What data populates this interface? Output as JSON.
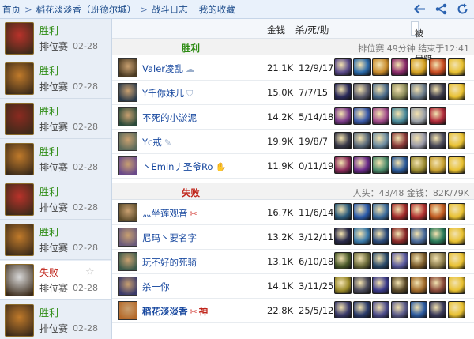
{
  "breadcrumb": {
    "home": "首页",
    "player": "稻花淡淡香（班德尔城）",
    "log": "战斗日志",
    "fav": "我的收藏",
    "sep": ">"
  },
  "toolbar_icons": [
    "back-arrow-icon",
    "share-icon",
    "refresh-icon"
  ],
  "sidebar": [
    {
      "result": "胜利",
      "kind": "win",
      "mode": "排位赛",
      "date": "02-28",
      "avatar_color": "#b8322a"
    },
    {
      "result": "胜利",
      "kind": "win",
      "mode": "排位赛",
      "date": "02-28",
      "avatar_color": "#c07a2a"
    },
    {
      "result": "胜利",
      "kind": "win",
      "mode": "排位赛",
      "date": "02-28",
      "avatar_color": "#8a2a20"
    },
    {
      "result": "胜利",
      "kind": "win",
      "mode": "排位赛",
      "date": "02-28",
      "avatar_color": "#c07a2a"
    },
    {
      "result": "胜利",
      "kind": "win",
      "mode": "排位赛",
      "date": "02-28",
      "avatar_color": "#b8322a"
    },
    {
      "result": "胜利",
      "kind": "win",
      "mode": "排位赛",
      "date": "02-28",
      "avatar_color": "#c07a2a"
    },
    {
      "result": "失败",
      "kind": "lose",
      "mode": "排位赛",
      "date": "02-28",
      "avatar_color": "#d8d8d8",
      "star": "☆"
    },
    {
      "result": "胜利",
      "kind": "win",
      "mode": "排位赛",
      "date": "02-28",
      "avatar_color": "#c07a2a"
    }
  ],
  "header": {
    "gold": "金钱",
    "kda": "杀/死/助",
    "ban": "被BAN英雄",
    "dropdown_icon": "⌄"
  },
  "win_team": {
    "label": "胜利",
    "meta": "排位赛 49分钟 结束于12:41"
  },
  "lose_team": {
    "label": "失败",
    "meta": "人头：43/48 金钱：82K/79K"
  },
  "win_rows": [
    {
      "name": "Valer凌乱",
      "gold": "21.1K",
      "kda": "12/9/17",
      "badge": "☁",
      "avatar": "#4a3a22"
    },
    {
      "name": "Y千你妹儿",
      "gold": "15.0K",
      "kda": "7/7/15",
      "badge": "⛉",
      "avatar": "#2a3a4a"
    },
    {
      "name": "不死的小淤泥",
      "gold": "14.2K",
      "kda": "5/14/18",
      "badge": "",
      "avatar": "#2a4a3a"
    },
    {
      "name": "Yc戒",
      "gold": "19.9K",
      "kda": "19/8/7",
      "badge": "✎",
      "avatar": "#5a6a5a"
    },
    {
      "name": "丶Emin丿圣爷Ro",
      "gold": "11.9K",
      "kda": "0/11/19",
      "badge": "✋",
      "avatar": "#6a4a8a"
    }
  ],
  "lose_rows": [
    {
      "name": "灬坐莲观音",
      "gold": "16.7K",
      "kda": "11/6/14",
      "badge": "✂",
      "avatar": "#5a4a2a"
    },
    {
      "name": "尼玛丶要名字",
      "gold": "13.2K",
      "kda": "3/12/11",
      "badge": "",
      "avatar": "#6a5a7a"
    },
    {
      "name": "玩不好的死骑",
      "gold": "13.1K",
      "kda": "6/10/18",
      "badge": "",
      "avatar": "#3a5a4a"
    },
    {
      "name": "杀一你",
      "gold": "14.1K",
      "kda": "3/11/25",
      "badge": "",
      "avatar": "#3a3a6a"
    },
    {
      "name": "稻花淡淡香",
      "gold": "22.8K",
      "kda": "25/5/12",
      "badge": "✂",
      "shen": "神",
      "me": true,
      "avatar": "#b56a2a"
    }
  ],
  "item_colors": [
    [
      "#5a4a8a",
      "#2a6aaa",
      "#c88a2a",
      "#8a2a6a",
      "#d4a020",
      "#c84a20",
      "#e8c030"
    ],
    [
      "#2a2a5a",
      "#5a5a6a",
      "#4a6a8a",
      "#8a8a5a",
      "#6a7a8a",
      "#3a3a4a",
      "#e8c030"
    ],
    [
      "#7a3a8a",
      "#3a5aaa",
      "#a04a8a",
      "#4a8a9a",
      "#9aa0a8",
      "#b02a3a"
    ],
    [
      "#3a3a4a",
      "#5a6a7a",
      "#6a8aa0",
      "#8a3a3a",
      "#9a9aa8",
      "#4a4a5a",
      "#e8c030"
    ],
    [
      "#8a2a5a",
      "#6a2a8a",
      "#4a8a6a",
      "#2a5a9a",
      "#9a8a30",
      "#c8a030",
      "#e8c030"
    ],
    [
      "#2a5a7a",
      "#2a5aaa",
      "#3a6a9a",
      "#a02a2a",
      "#b03030",
      "#c05a20",
      "#e8c030"
    ],
    [
      "#2a2a4a",
      "#3a7aaa",
      "#2a4a7a",
      "#8a2a2a",
      "#4a6a9a",
      "#2a7a5a",
      "#e8c030"
    ],
    [
      "#4a5a2a",
      "#6a6a3a",
      "#2a4a6a",
      "#5a5aa0",
      "#7a5a2a",
      "#8a7a4a",
      "#e8c030"
    ],
    [
      "#9a8a2a",
      "#4a4a5a",
      "#3a3a8a",
      "#5a4a2a",
      "#a06a2a",
      "#8a4a3a",
      "#e8c030"
    ],
    [
      "#3a3a6a",
      "#2a3a6a",
      "#4a4a8a",
      "#5a5a8a",
      "#2a5aa0",
      "#3a3a5a",
      "#e8c030"
    ]
  ]
}
